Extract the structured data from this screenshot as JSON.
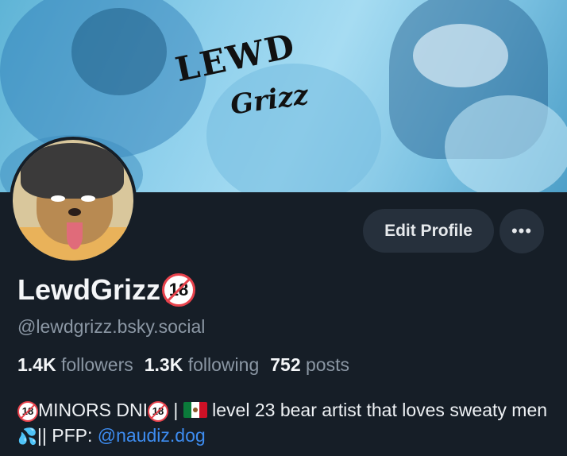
{
  "banner": {
    "logo_line1": "LEWD",
    "logo_line2": "Grizz"
  },
  "profile": {
    "display_name": "LewdGrizz",
    "badge_text": "18",
    "handle": "@lewdgrizz.bsky.social",
    "stats": {
      "followers_count": "1.4K",
      "followers_label": "followers",
      "following_count": "1.3K",
      "following_label": "following",
      "posts_count": "752",
      "posts_label": "posts"
    },
    "bio": {
      "minors_text": "MINORS DNI",
      "separator": " | ",
      "level_text": " level 23 bear artist that loves sweaty men",
      "drops_emoji": "💦",
      "pfp_prefix": "|| PFP: ",
      "pfp_link": "@naudiz.dog"
    }
  },
  "actions": {
    "edit_profile_label": "Edit Profile",
    "more_label": "•••"
  },
  "colors": {
    "background": "#161e27",
    "button_bg": "#26303c",
    "link": "#3d8cf0",
    "muted": "#8b97a4",
    "badge_red": "#e8424c"
  },
  "icons": {
    "more": "ellipsis-icon",
    "under18": "under-18-icon",
    "flag": "mexico-flag-icon",
    "drops": "sweat-droplets-icon"
  }
}
